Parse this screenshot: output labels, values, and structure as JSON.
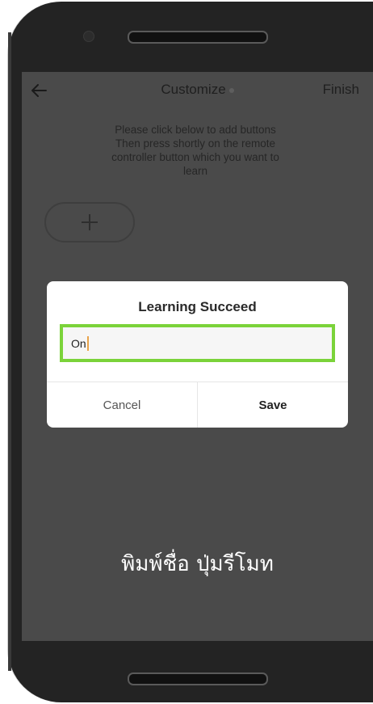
{
  "header": {
    "title": "Customize",
    "finish_label": "Finish",
    "back_icon": "arrow-left-icon"
  },
  "instructions": {
    "line1": "Please click below to add buttons",
    "line2": "Then press shortly on the remote",
    "line3": "controller button which you want to",
    "line4": "learn"
  },
  "add_button": {
    "icon": "plus-icon"
  },
  "dialog": {
    "title": "Learning Succeed",
    "name_value": "On",
    "cancel_label": "Cancel",
    "save_label": "Save"
  },
  "caption": {
    "text": "พิมพ์ชื่อ ปุ่มรีโมท"
  },
  "colors": {
    "field_border": "#7bd33a",
    "caret": "#e8a34a",
    "screen_dim": "#4a4a4a"
  }
}
